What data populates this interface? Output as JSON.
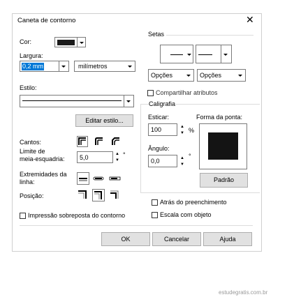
{
  "dialog": {
    "title": "Caneta de contorno"
  },
  "left": {
    "color_label": "Cor:",
    "color_value": "#1a1a1a",
    "width_label": "Largura:",
    "width_value": "0,2 mm",
    "width_unit": "milímetros",
    "style_label": "Estilo:",
    "edit_style_button": "Editar estilo...",
    "corners_label": "Cantos:",
    "miter_limit_label_1": "Limite de",
    "miter_limit_label_2": "meia-esquadria:",
    "miter_limit_value": "5,0",
    "miter_limit_unit": "°",
    "line_caps_label_1": "Extremidades da",
    "line_caps_label_2": "linha:",
    "position_label": "Posição:",
    "overprint_label": "Impressão sobreposta do contorno"
  },
  "arrows": {
    "group_label": "Setas",
    "options_left": "Opções",
    "options_right": "Opções",
    "share_attributes_label": "Compartilhar atributos"
  },
  "calligraphy": {
    "group_label": "Caligrafia",
    "stretch_label": "Esticar:",
    "stretch_value": "100",
    "stretch_unit": "%",
    "angle_label": "Ângulo:",
    "angle_value": "0,0",
    "angle_unit": "°",
    "nib_shape_label": "Forma da ponta:",
    "default_button": "Padrão"
  },
  "options": {
    "behind_fill_label": "Atrás do preenchimento",
    "scale_with_object_label": "Escala com objeto"
  },
  "footer": {
    "ok": "OK",
    "cancel": "Cancelar",
    "help": "Ajuda"
  },
  "watermark": "estudegratis.com.br"
}
